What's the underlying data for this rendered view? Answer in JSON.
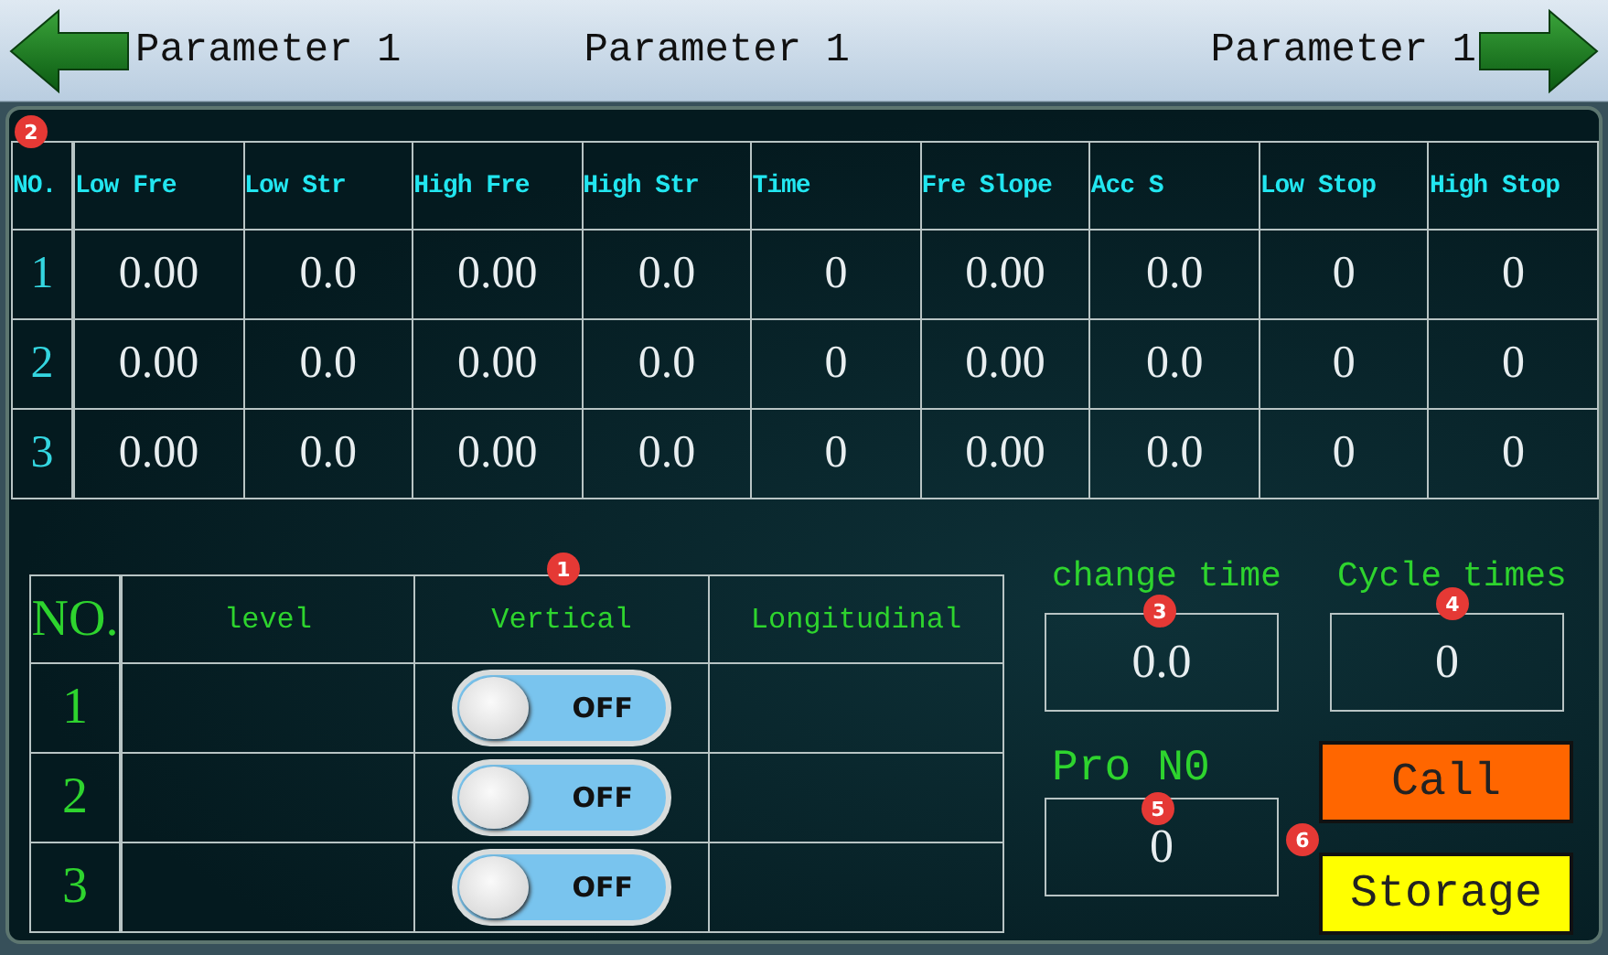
{
  "header": {
    "back_title": "Parameter 1",
    "title": "Parameter 1",
    "next_title": "Parameter 1"
  },
  "parameter_table": {
    "columns": [
      "NO.",
      "Low Fre",
      "Low Str",
      "High Fre",
      "High Str",
      "Time",
      "Fre Slope",
      "Acc S",
      "Low Stop",
      "High Stop"
    ],
    "rows": [
      [
        "1",
        "0.00",
        "0.0",
        "0.00",
        "0.0",
        "0",
        "0.00",
        "0.0",
        "0",
        "0"
      ],
      [
        "2",
        "0.00",
        "0.0",
        "0.00",
        "0.0",
        "0",
        "0.00",
        "0.0",
        "0",
        "0"
      ],
      [
        "3",
        "0.00",
        "0.0",
        "0.00",
        "0.0",
        "0",
        "0.00",
        "0.0",
        "0",
        "0"
      ]
    ]
  },
  "direction_table": {
    "columns": [
      "NO.",
      "level",
      "Vertical",
      "Longitudinal"
    ],
    "rows": [
      {
        "no": "1",
        "vertical": {
          "label": "OFF",
          "on": false
        }
      },
      {
        "no": "2",
        "vertical": {
          "label": "OFF",
          "on": false
        }
      },
      {
        "no": "3",
        "vertical": {
          "label": "OFF",
          "on": false
        }
      }
    ]
  },
  "fields": [
    {
      "label": "change time",
      "value": "0.0"
    },
    {
      "label": "Cycle times",
      "value": "0"
    },
    {
      "label": "Pro N0",
      "value": "0"
    }
  ],
  "buttons": [
    {
      "label": "Call",
      "color": "#ff6600"
    },
    {
      "label": "Storage",
      "color": "#ffff00"
    }
  ],
  "markers": [
    "1",
    "2",
    "3",
    "4",
    "5",
    "6"
  ]
}
